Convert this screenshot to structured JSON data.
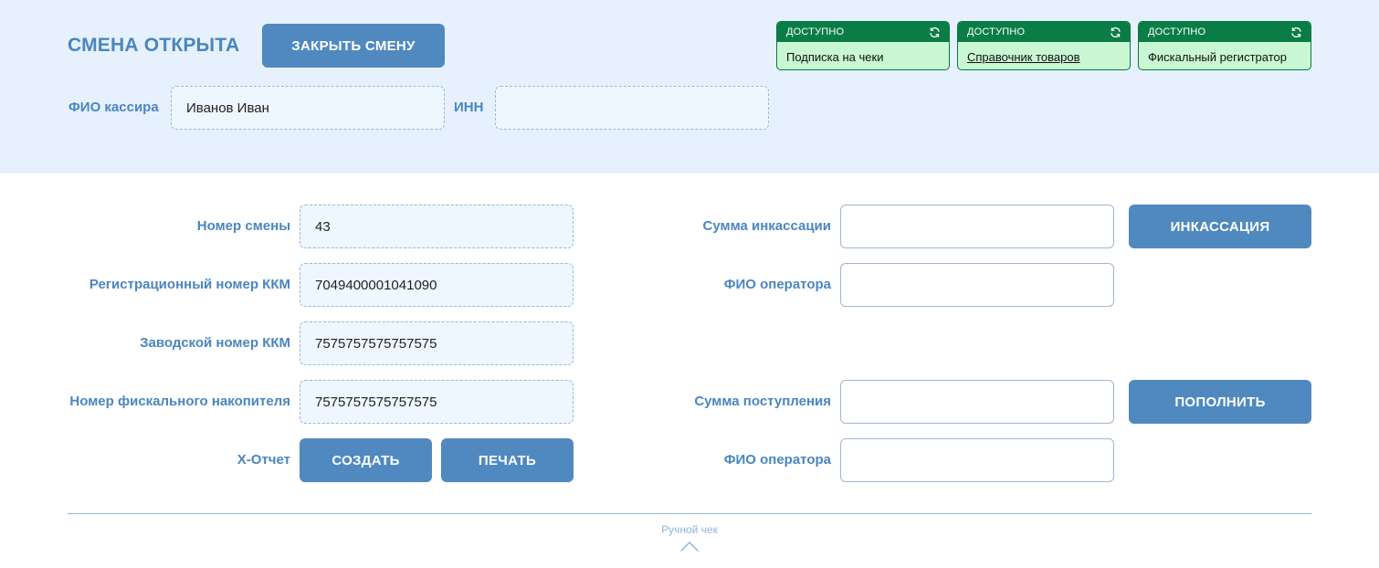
{
  "header": {
    "shift_status": "СМЕНА ОТКРЫТА",
    "close_shift_label": "ЗАКРЫТЬ СМЕНУ",
    "cashier_label": "ФИО кассира",
    "cashier_value": "Иванов Иван",
    "inn_label": "ИНН",
    "inn_value": ""
  },
  "status_cards": [
    {
      "status": "ДОСТУПНО",
      "name": "Подписка на чеки",
      "icon": "refresh-icon"
    },
    {
      "status": "ДОСТУПНО",
      "name": "Справочник товаров",
      "icon": "refresh-icon"
    },
    {
      "status": "ДОСТУПНО",
      "name": "Фискальный регистратор",
      "icon": "refresh-icon"
    }
  ],
  "kkm_info": {
    "shift_number_label": "Номер смены",
    "shift_number": "43",
    "reg_number_label": "Регистрационный номер ККМ",
    "reg_number": "7049400001041090",
    "factory_number_label": "Заводской номер ККМ",
    "factory_number": "7575757575757575",
    "fn_number_label": "Номер фискального накопителя",
    "fn_number": "7575757575757575",
    "x_report_label": "Х-Отчет",
    "create_label": "СОЗДАТЬ",
    "print_label": "ПЕЧАТЬ"
  },
  "cash_ops": {
    "collection_sum_label": "Сумма инкассации",
    "collection_sum": "",
    "collection_operator_label": "ФИО оператора",
    "collection_operator": "",
    "collection_button": "ИНКАССАЦИЯ",
    "income_sum_label": "Сумма поступления",
    "income_sum": "",
    "income_operator_label": "ФИО оператора",
    "income_operator": "",
    "income_button": "ПОПОЛНИТЬ"
  },
  "footer": {
    "manual_check_label": "Ручной чек",
    "icon": "chevron-up-icon"
  },
  "colors": {
    "accent": "#5089c0",
    "label": "#4a86bf",
    "panel_bg": "#e6f1fd",
    "status_head": "#0a7d47",
    "status_body": "#c9f7d3"
  }
}
